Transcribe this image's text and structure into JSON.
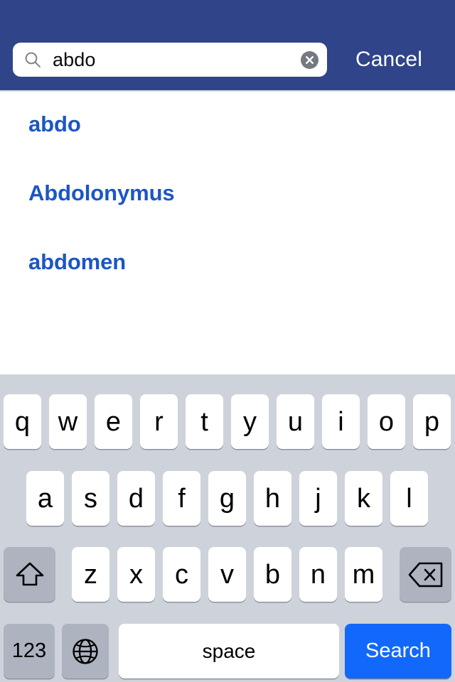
{
  "navbar": {
    "background_color": "#2F4489",
    "search": {
      "value": "abdo",
      "placeholder": "Search",
      "icon": "search-icon",
      "clear_icon": "clear-circle-icon"
    },
    "cancel_label": "Cancel"
  },
  "suggestions": {
    "text_color": "#1B56C4",
    "items": [
      {
        "label": "abdo"
      },
      {
        "label": "Abdolonymus"
      },
      {
        "label": "abdomen"
      }
    ]
  },
  "keyboard": {
    "background_color": "#CED3DB",
    "key_color": "#FFFFFF",
    "function_key_color": "#ADB3BF",
    "action_key_color": "#1268FB",
    "row1": [
      {
        "label": "q"
      },
      {
        "label": "w"
      },
      {
        "label": "e"
      },
      {
        "label": "r"
      },
      {
        "label": "t"
      },
      {
        "label": "y"
      },
      {
        "label": "u"
      },
      {
        "label": "i"
      },
      {
        "label": "o"
      },
      {
        "label": "p"
      }
    ],
    "row2": [
      {
        "label": "a"
      },
      {
        "label": "s"
      },
      {
        "label": "d"
      },
      {
        "label": "f"
      },
      {
        "label": "g"
      },
      {
        "label": "h"
      },
      {
        "label": "j"
      },
      {
        "label": "k"
      },
      {
        "label": "l"
      }
    ],
    "row3": [
      {
        "label": "z"
      },
      {
        "label": "x"
      },
      {
        "label": "c"
      },
      {
        "label": "v"
      },
      {
        "label": "b"
      },
      {
        "label": "n"
      },
      {
        "label": "m"
      }
    ],
    "shift": {
      "icon": "shift-arrow-icon",
      "label": ""
    },
    "backspace": {
      "icon": "backspace-icon",
      "label": ""
    },
    "numbers": {
      "label": "123"
    },
    "globe": {
      "icon": "globe-icon",
      "label": ""
    },
    "space": {
      "label": "space"
    },
    "action": {
      "label": "Search"
    }
  }
}
